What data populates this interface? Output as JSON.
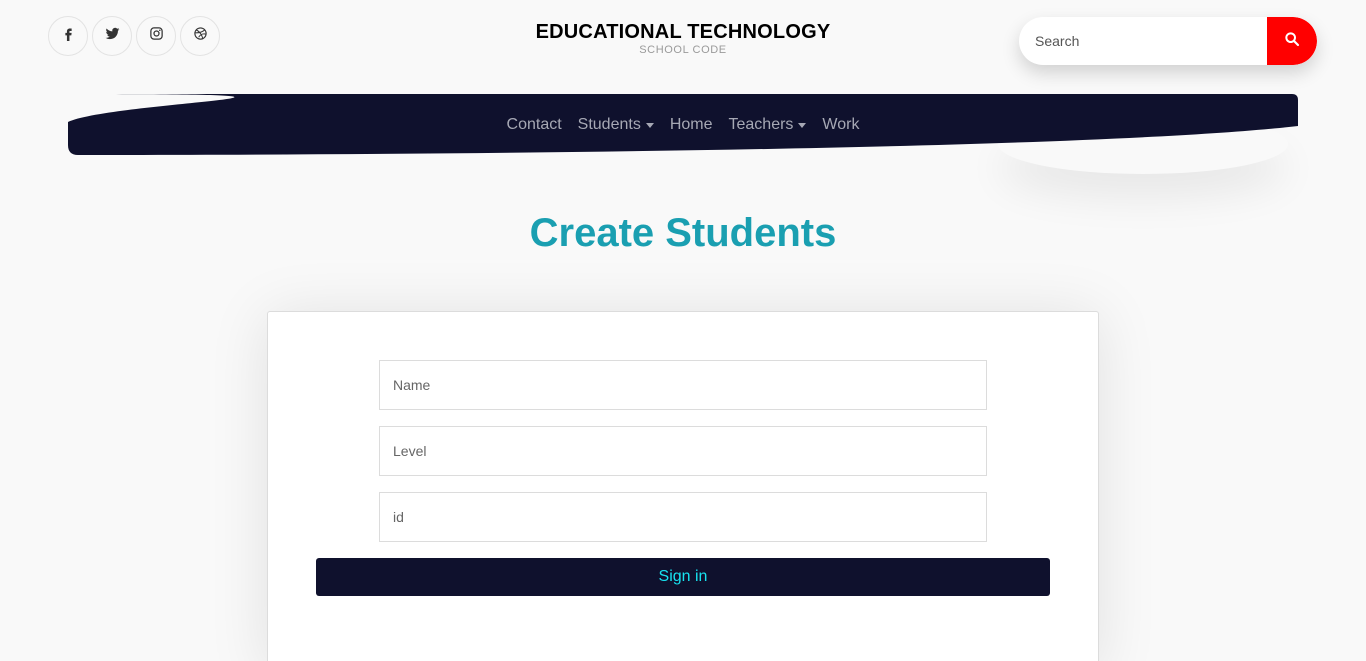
{
  "social": [
    {
      "icon": "facebook-icon"
    },
    {
      "icon": "twitter-icon"
    },
    {
      "icon": "instagram-icon"
    },
    {
      "icon": "dribbble-icon"
    }
  ],
  "brand": {
    "title": "EDUCATIONAL TECHNOLOGY",
    "subtitle": "SCHOOL CODE"
  },
  "search": {
    "placeholder": "Search",
    "icon": "search-icon",
    "accent": "#ff0000"
  },
  "nav": {
    "items": [
      {
        "label": "Contact",
        "dropdown": false
      },
      {
        "label": "Students",
        "dropdown": true
      },
      {
        "label": "Home",
        "dropdown": false
      },
      {
        "label": "Teachers",
        "dropdown": true
      },
      {
        "label": "Work",
        "dropdown": false
      }
    ],
    "background": "#0f112d"
  },
  "main": {
    "title": "Create Students",
    "title_color": "#1a9fb1"
  },
  "form": {
    "name_placeholder": "Name",
    "level_placeholder": "Level",
    "id_placeholder": "id",
    "submit_label": "Sign in",
    "submit_text_color": "#17e3f0"
  }
}
